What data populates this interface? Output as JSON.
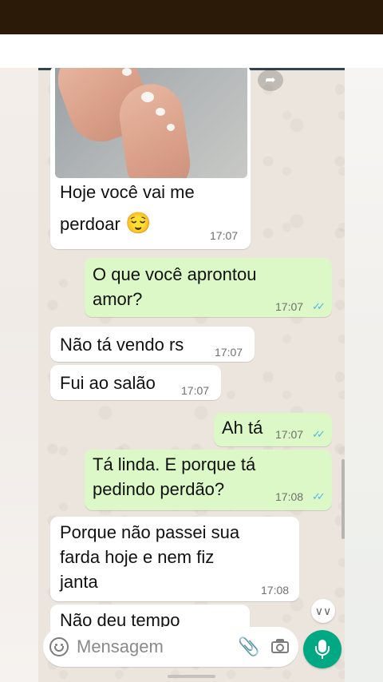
{
  "chat": {
    "messages": [
      {
        "id": "m1",
        "direction": "incoming",
        "has_image": true,
        "text_line1": "Hoje você vai me",
        "text_line2": "perdoar",
        "emoji": "😌",
        "time": "17:07"
      },
      {
        "id": "m2",
        "direction": "outgoing",
        "text_line1": "O que você aprontou",
        "text_line2": "amor?",
        "time": "17:07",
        "ticks": "✓✓"
      },
      {
        "id": "m3",
        "direction": "incoming",
        "text": "Não tá vendo rs",
        "time": "17:07"
      },
      {
        "id": "m4",
        "direction": "incoming",
        "text": "Fui ao salão",
        "time": "17:07"
      },
      {
        "id": "m5",
        "direction": "outgoing",
        "text": "Ah tá",
        "time": "17:07",
        "ticks": "✓✓"
      },
      {
        "id": "m6",
        "direction": "outgoing",
        "text_line1": "Tá linda. E porque tá",
        "text_line2": "pedindo perdão?",
        "time": "17:08",
        "ticks": "✓✓"
      },
      {
        "id": "m7",
        "direction": "incoming",
        "text_line1": "Porque não passei sua",
        "text_line2": "farda hoje e nem fiz",
        "text_line3": "janta",
        "time": "17:08"
      },
      {
        "id": "m8",
        "direction": "incoming",
        "text": "Não deu tempo",
        "partially_hidden": true
      }
    ]
  },
  "composer": {
    "placeholder": "Mensagem",
    "emoji_icon": "emoji-icon",
    "attach_icon": "paperclip-icon",
    "camera_icon": "camera-icon",
    "mic_icon": "mic-icon"
  },
  "controls": {
    "forward_icon": "forward-icon",
    "scroll_down_icon": "chevron-double-down-icon"
  },
  "colors": {
    "incoming_bubble": "#ffffff",
    "outgoing_bubble": "#dcf8c6",
    "read_ticks": "#4fb6ec",
    "chat_background": "#ece5dd",
    "mic_button": "#00a884",
    "top_bar": "#2b1a08"
  }
}
